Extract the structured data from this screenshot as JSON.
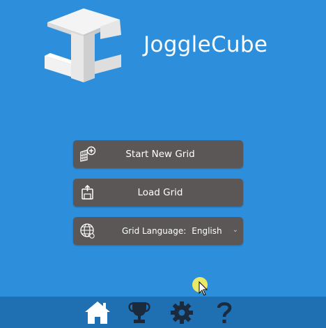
{
  "app": {
    "title": "JoggleCube"
  },
  "menu": {
    "start_new_grid": "Start New Grid",
    "load_grid": "Load Grid",
    "grid_language_label": "Grid Language:",
    "grid_language_value": "English"
  },
  "colors": {
    "background": "#2d8fdc",
    "footer": "#1f6fb3",
    "button": "#5b5757",
    "text": "#ffffff"
  },
  "icons": {
    "logo": "jogglecube-logo",
    "start": "cube-grid-add-icon",
    "load": "load-file-icon",
    "language": "globe-icon",
    "nav": [
      "home-icon",
      "trophy-icon",
      "gear-icon",
      "help-icon"
    ]
  }
}
